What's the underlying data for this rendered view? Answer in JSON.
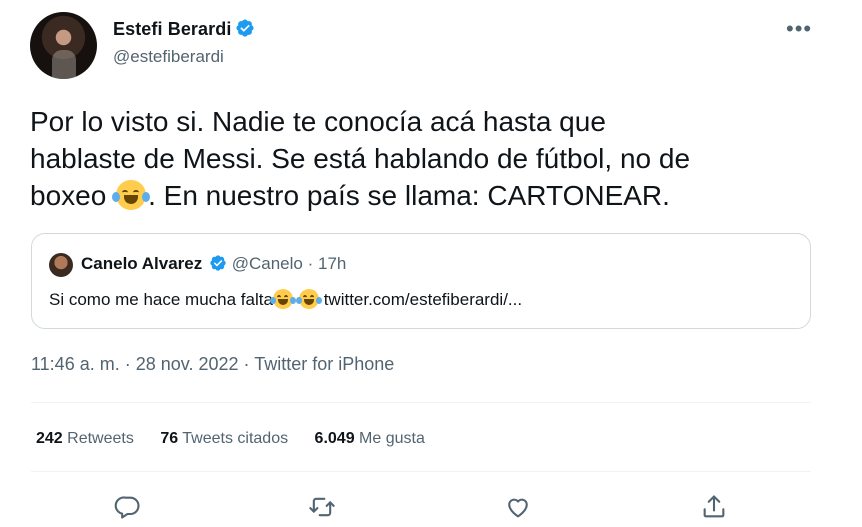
{
  "author": {
    "name": "Estefi Berardi",
    "handle": "@estefiberardi"
  },
  "more_label": "•••",
  "tweet": {
    "text_part1": "Por lo visto si. Nadie te conocía acá hasta que\nhablaste de Messi. Se está hablando de fútbol, no de\nboxeo ",
    "text_part2": ". En nuestro país se llama: CARTONEAR."
  },
  "quote": {
    "name": "Canelo Alvarez",
    "handle": "@Canelo",
    "separator": "·",
    "time": "17h",
    "text": "Si como me hace mucha falta",
    "link": "twitter.com/estefiberardi/..."
  },
  "meta": {
    "time": "11:46 a. m.",
    "sep1": "·",
    "date": "28 nov. 2022",
    "sep2": "·",
    "source": "Twitter for iPhone"
  },
  "stats": {
    "retweets_count": "242",
    "retweets_label": "Retweets",
    "quotes_count": "76",
    "quotes_label": "Tweets citados",
    "likes_count": "6.049",
    "likes_label": "Me gusta"
  },
  "icons": {
    "verified": "verified-badge-icon",
    "reply": "reply-icon",
    "retweet": "retweet-icon",
    "like": "like-icon",
    "share": "share-icon",
    "emoji": "face-with-tears-of-joy"
  },
  "colors": {
    "verified": "#1d9bf0",
    "secondary_text": "#536471",
    "border": "#cfd9de"
  }
}
